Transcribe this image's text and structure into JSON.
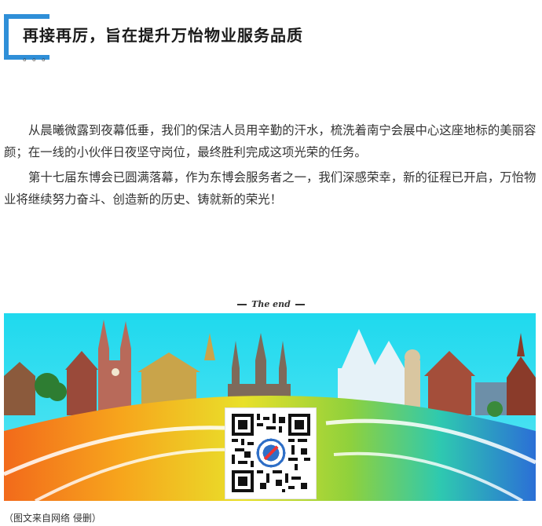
{
  "header": {
    "title": "再接再厉，旨在提升万怡物业服务品质",
    "dots": "。。。"
  },
  "article": {
    "paragraphs": [
      "从晨曦微露到夜幕低垂，我们的保洁人员用辛勤的汗水，梳洗着南宁会展中心这座地标的美丽容颜；在一线的小伙伴日夜坚守岗位，最终胜利完成这项光荣的任务。",
      "第十七届东博会已圆满落幕，作为东博会服务者之一，我们深感荣幸，新的征程已开启，万怡物业将继续努力奋斗、创造新的历史、铸就新的荣光！"
    ]
  },
  "footer": {
    "the_end": "The end",
    "caption": "（图文来自网络 侵删）"
  },
  "colors": {
    "accent": "#2f8fd8",
    "sky": "#27dff0"
  },
  "icons": [
    "qr-code-icon"
  ]
}
